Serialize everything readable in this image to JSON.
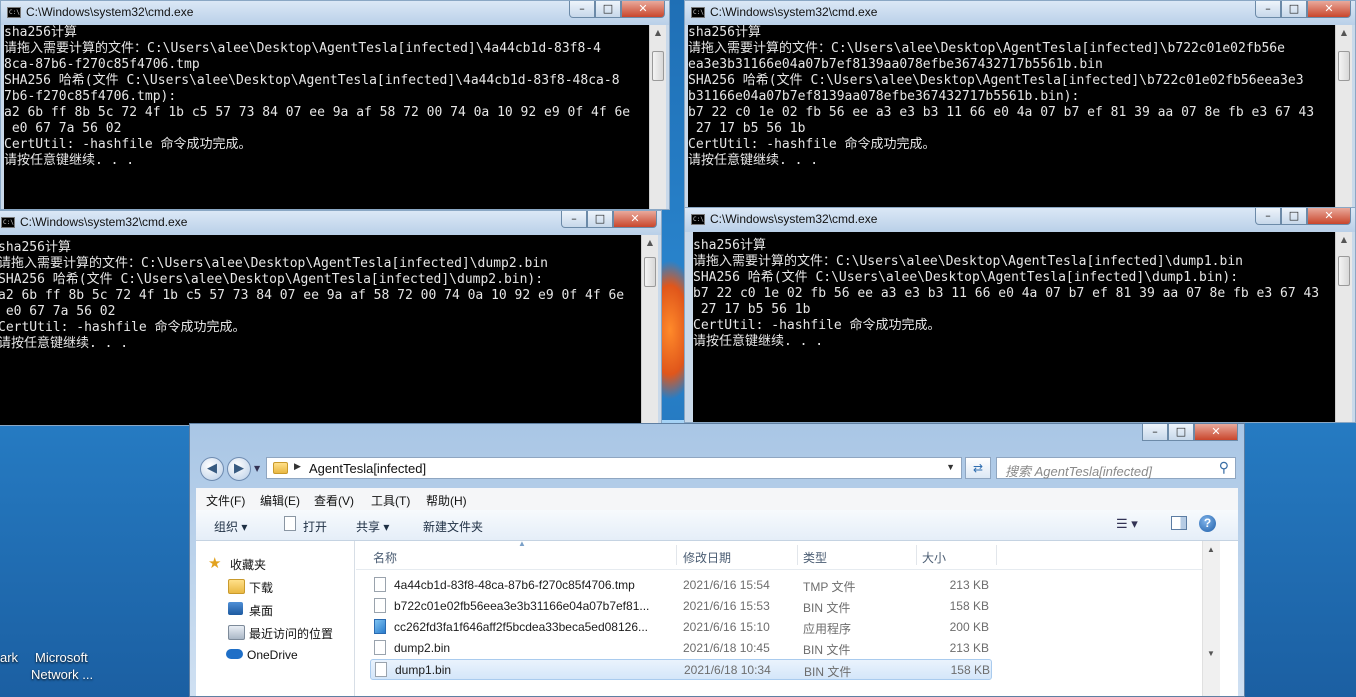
{
  "desktop": {
    "icons": [
      "ark",
      "Microsoft",
      "Network ..."
    ]
  },
  "cmd_windows": [
    {
      "title": "C:\\Windows\\system32\\cmd.exe",
      "lines": [
        "sha256计算",
        "请拖入需要计算的文件：C:\\Users\\alee\\Desktop\\AgentTesla[infected]\\4a44cb1d-83f8-4",
        "8ca-87b6-f270c85f4706.tmp",
        "SHA256 哈希(文件 C:\\Users\\alee\\Desktop\\AgentTesla[infected]\\4a44cb1d-83f8-48ca-8",
        "7b6-f270c85f4706.tmp):",
        "a2 6b ff 8b 5c 72 4f 1b c5 57 73 84 07 ee 9a af 58 72 00 74 0a 10 92 e9 0f 4f 6e",
        " e0 67 7a 56 02",
        "CertUtil: -hashfile 命令成功完成。",
        "请按任意键继续. . ."
      ]
    },
    {
      "title": "C:\\Windows\\system32\\cmd.exe",
      "lines": [
        "sha256计算",
        "请拖入需要计算的文件：C:\\Users\\alee\\Desktop\\AgentTesla[infected]\\b722c01e02fb56e",
        "ea3e3b31166e04a07b7ef8139aa078efbe367432717b5561b.bin",
        "SHA256 哈希(文件 C:\\Users\\alee\\Desktop\\AgentTesla[infected]\\b722c01e02fb56eea3e3",
        "b31166e04a07b7ef8139aa078efbe367432717b5561b.bin):",
        "b7 22 c0 1e 02 fb 56 ee a3 e3 b3 11 66 e0 4a 07 b7 ef 81 39 aa 07 8e fb e3 67 43",
        " 27 17 b5 56 1b",
        "CertUtil: -hashfile 命令成功完成。",
        "请按任意键继续. . ."
      ]
    },
    {
      "title": "C:\\Windows\\system32\\cmd.exe",
      "lines": [
        "sha256计算",
        "请拖入需要计算的文件：C:\\Users\\alee\\Desktop\\AgentTesla[infected]\\dump2.bin",
        "SHA256 哈希(文件 C:\\Users\\alee\\Desktop\\AgentTesla[infected]\\dump2.bin):",
        "a2 6b ff 8b 5c 72 4f 1b c5 57 73 84 07 ee 9a af 58 72 00 74 0a 10 92 e9 0f 4f 6e",
        " e0 67 7a 56 02",
        "CertUtil: -hashfile 命令成功完成。",
        "请按任意键继续. . ."
      ]
    },
    {
      "title": "C:\\Windows\\system32\\cmd.exe",
      "lines": [
        "sha256计算",
        "请拖入需要计算的文件：C:\\Users\\alee\\Desktop\\AgentTesla[infected]\\dump1.bin",
        "SHA256 哈希(文件 C:\\Users\\alee\\Desktop\\AgentTesla[infected]\\dump1.bin):",
        "b7 22 c0 1e 02 fb 56 ee a3 e3 b3 11 66 e0 4a 07 b7 ef 81 39 aa 07 8e fb e3 67 43",
        " 27 17 b5 56 1b",
        "CertUtil: -hashfile 命令成功完成。",
        "请按任意键继续. . ."
      ]
    }
  ],
  "explorer": {
    "address": "AgentTesla[infected]",
    "search_placeholder": "搜索 AgentTesla[infected]",
    "menu": [
      "文件(F)",
      "编辑(E)",
      "查看(V)",
      "工具(T)",
      "帮助(H)"
    ],
    "toolbar": {
      "organize": "组织 ▾",
      "open": "打开",
      "share": "共享 ▾",
      "new_folder": "新建文件夹"
    },
    "nav": {
      "favorites": "收藏夹",
      "downloads": "下载",
      "desktop": "桌面",
      "recent": "最近访问的位置",
      "onedrive": "OneDrive"
    },
    "columns": [
      "名称",
      "修改日期",
      "类型",
      "大小"
    ],
    "files": [
      {
        "name": "4a44cb1d-83f8-48ca-87b6-f270c85f4706.tmp",
        "date": "2021/6/16 15:54",
        "type": "TMP 文件",
        "size": "213 KB"
      },
      {
        "name": "b722c01e02fb56eea3e3b31166e04a07b7ef81...",
        "date": "2021/6/16 15:53",
        "type": "BIN 文件",
        "size": "158 KB"
      },
      {
        "name": "cc262fd3fa1f646aff2f5bcdea33beca5ed08126...",
        "date": "2021/6/16 15:10",
        "type": "应用程序",
        "size": "200 KB"
      },
      {
        "name": "dump2.bin",
        "date": "2021/6/18 10:45",
        "type": "BIN 文件",
        "size": "213 KB"
      },
      {
        "name": "dump1.bin",
        "date": "2021/6/18 10:34",
        "type": "BIN 文件",
        "size": "158 KB"
      }
    ]
  }
}
